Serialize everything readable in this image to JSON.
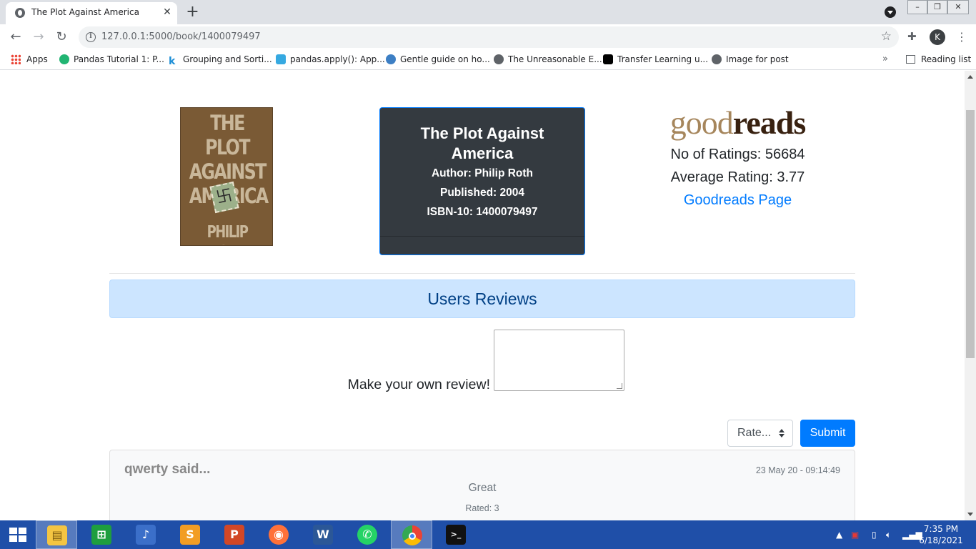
{
  "browser": {
    "tab_title": "The Plot Against America",
    "tab_close": "✕",
    "new_tab": "+",
    "url": "127.0.0.1:5000/book/1400079497",
    "profile_initial": "K",
    "bookmarks": [
      {
        "label": "Apps",
        "icon": "apps-grid-icon"
      },
      {
        "label": "Pandas Tutorial 1: P...",
        "icon": "bookmark-favicon-icon",
        "color": "#21b573"
      },
      {
        "label": "Grouping and Sorti...",
        "icon": "bookmark-favicon-icon",
        "color": "#1c8ed6"
      },
      {
        "label": "pandas.apply(): App...",
        "icon": "bookmark-favicon-icon",
        "color": "#36a9e1"
      },
      {
        "label": "Gentle guide on ho...",
        "icon": "bookmark-favicon-icon",
        "color": "#3d7fc4"
      },
      {
        "label": "The Unreasonable E...",
        "icon": "globe-icon",
        "color": "#5f6368"
      },
      {
        "label": "Transfer Learning u...",
        "icon": "bookmark-favicon-icon",
        "color": "#000000"
      },
      {
        "label": "Image for post",
        "icon": "globe-icon",
        "color": "#5f6368"
      }
    ],
    "overflow": "»",
    "reading_list": "Reading list"
  },
  "book": {
    "cover_title": "THE PLOT AGAINST AMERICA",
    "cover_author": "PHILIP ROTH",
    "title": "The Plot Against America",
    "author": "Author: Philip Roth",
    "published": "Published: 2004",
    "isbn": "ISBN-10: 1400079497"
  },
  "goodreads": {
    "logo_light": "good",
    "logo_bold": "reads",
    "ratings_count": "No of Ratings: 56684",
    "average_rating": "Average Rating: 3.77",
    "page_link": "Goodreads Page"
  },
  "reviews": {
    "heading": "Users Reviews",
    "prompt": "Make your own review!",
    "rate_placeholder": "Rate...",
    "submit_label": "Submit",
    "items": [
      {
        "user": "qwerty said...",
        "timestamp": "23 May 20 - 09:14:49",
        "text": "Great",
        "rated": "Rated: 3"
      }
    ]
  },
  "taskbar": {
    "time": "7:35 PM",
    "date": "6/18/2021"
  },
  "colors": {
    "primary": "#007bff",
    "card_dark": "#343a40",
    "alert_bg": "#cce5ff",
    "alert_text": "#004085",
    "taskbar": "#1f4fa8"
  }
}
